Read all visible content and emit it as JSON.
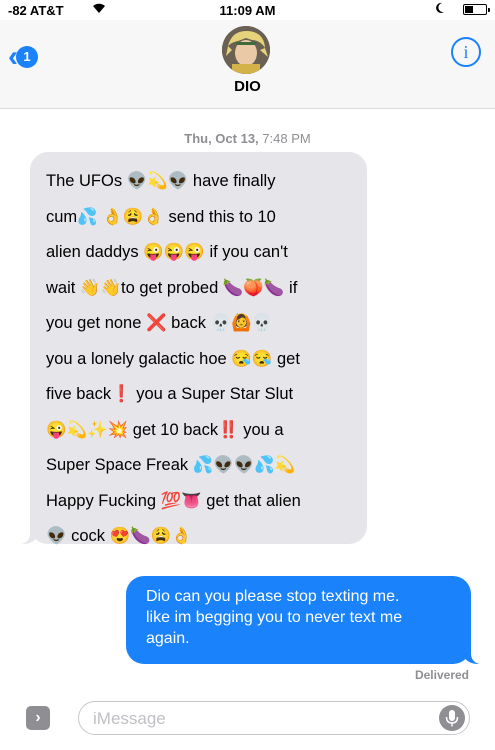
{
  "status_bar": {
    "carrier": "-82 AT&T",
    "wifi_icon": "wifi-icon",
    "time": "11:09 AM",
    "dnd_icon": "moon-icon",
    "battery_level": 0.4
  },
  "header": {
    "back_icon": "chevron-left-icon",
    "unread_count": "1",
    "contact_name": "DIO",
    "info_label": "i"
  },
  "conversation": {
    "timestamp_day": "Thu, Oct 13,",
    "timestamp_time": "7:48 PM",
    "incoming_lines": [
      "The UFOs 👽💫👽 have finally",
      "cum💦 👌😩👌 send this to 10",
      "alien daddys 😜😜😜 if you can't",
      "wait 👋👋to get probed 🍆🍑🍆 if",
      "you get none ❌ back 💀🙆💀",
      "you a lonely galactic hoe 😪😪 get",
      "five back❗ you a Super Star Slut",
      "😜💫✨💥 get 10 back‼️ you a",
      "Super Space Freak 💦👽👽💦💫",
      "Happy Fucking 💯👅 get that alien",
      "👽 cock 😍🍆😩👌"
    ],
    "outgoing_lines": [
      "Dio can you please stop texting me.",
      "like im begging you to never text me",
      "again."
    ],
    "delivery_status": "Delivered"
  },
  "input_bar": {
    "expand_icon": "chevron-right-icon",
    "placeholder": "iMessage",
    "mic_icon": "microphone-icon"
  },
  "colors": {
    "accent": "#1a82fb",
    "incoming_bubble": "#e5e5ea",
    "outgoing_bubble": "#1a82fb"
  }
}
